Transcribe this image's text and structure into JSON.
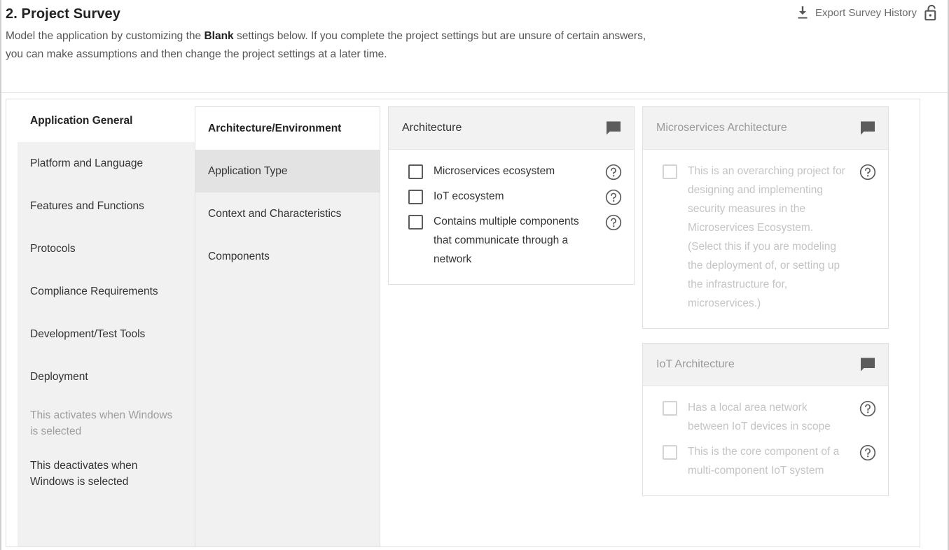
{
  "header": {
    "title": "2. Project Survey",
    "description_pre": "Model the application by customizing the ",
    "description_bold": "Blank",
    "description_post": " settings below. If you complete the project settings but are unsure of certain answers, you can make assumptions and then change the project settings at a later time.",
    "export_label": "Export Survey History",
    "download_icon": "download-icon",
    "lock_icon": "unlocked-padlock-icon"
  },
  "sidebar": {
    "items": [
      {
        "label": "Application General",
        "state": "active"
      },
      {
        "label": "Platform and Language",
        "state": "normal"
      },
      {
        "label": "Features and Functions",
        "state": "normal"
      },
      {
        "label": "Protocols",
        "state": "normal"
      },
      {
        "label": "Compliance Requirements",
        "state": "normal"
      },
      {
        "label": "Development/Test Tools",
        "state": "normal"
      },
      {
        "label": "Deployment",
        "state": "normal"
      },
      {
        "label": "This activates when Windows is selected",
        "state": "disabled"
      },
      {
        "label": "This deactivates when Windows is selected",
        "state": "normal"
      }
    ]
  },
  "subnav": {
    "items": [
      {
        "label": "Architecture/Environment",
        "state": "active-top"
      },
      {
        "label": "Application Type",
        "state": "selected"
      },
      {
        "label": "Context and Characteristics",
        "state": "normal"
      },
      {
        "label": "Components",
        "state": "normal"
      }
    ]
  },
  "cards": {
    "column_left": [
      {
        "title": "Architecture",
        "disabled": false,
        "comment_icon": "comment-icon",
        "options": [
          {
            "label": "Microservices ecosystem",
            "checked": false,
            "help_icon": "help-circle-icon"
          },
          {
            "label": "IoT ecosystem",
            "checked": false,
            "help_icon": "help-circle-icon"
          },
          {
            "label": "Contains multiple components that communicate through a network",
            "checked": false,
            "help_icon": "help-circle-icon"
          }
        ]
      }
    ],
    "column_right": [
      {
        "title": "Microservices Architecture",
        "disabled": true,
        "comment_icon": "comment-icon",
        "options": [
          {
            "label": "This is an overarching project for designing and implementing security measures in the Microservices Ecosystem. (Select this if you are modeling the deployment of, or setting up the infrastructure for, microservices.)",
            "checked": false,
            "help_icon": "help-circle-icon"
          }
        ]
      },
      {
        "title": "IoT Architecture",
        "disabled": true,
        "comment_icon": "comment-icon",
        "options": [
          {
            "label": "Has a local area network between IoT devices in scope",
            "checked": false,
            "help_icon": "help-circle-icon"
          },
          {
            "label": "This is the core component of a multi-component IoT system",
            "checked": false,
            "help_icon": "help-circle-icon"
          }
        ]
      }
    ]
  },
  "colors": {
    "panel_gray": "#f1f1f1",
    "card_head_gray": "#f2f2f2",
    "selected_gray": "#e3e3e3",
    "border": "#e0e0e0",
    "text": "#333333",
    "disabled_text": "#c4c4c4",
    "icon_gray": "#5c5c5c"
  }
}
